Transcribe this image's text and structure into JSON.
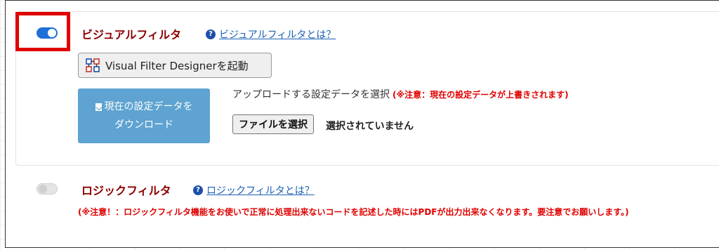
{
  "visual_filter": {
    "enabled": true,
    "title": "ビジュアルフィルタ",
    "help_icon": "question-circle-icon",
    "help_link": "ビジュアルフィルタとは？",
    "designer_icon": "designer-grid-icon",
    "designer_button": "Visual Filter Designerを起動",
    "download_button_line1": "現在の設定データを",
    "download_button_line2": "ダウンロード",
    "upload_label": "アップロードする設定データを選択",
    "upload_warning": "(※注意：現在の設定データが上書きされます)",
    "file_button": "ファイルを選択",
    "file_status": "選択されていません"
  },
  "logic_filter": {
    "enabled": false,
    "title": "ロジックフィルタ",
    "help_icon": "question-circle-icon",
    "help_link": "ロジックフィルタとは？",
    "warning": "(※注意！：ロジックフィルタ機能をお使いで正常に処理出来ないコードを記述した時にはPDFが出力出来なくなります。要注意でお願いします。)"
  },
  "colors": {
    "heading": "#8b0000",
    "warning": "#e00000",
    "toggle_on": "#1e6fd9",
    "download_button": "#5ea3d1",
    "highlight_box": "#e00000"
  }
}
